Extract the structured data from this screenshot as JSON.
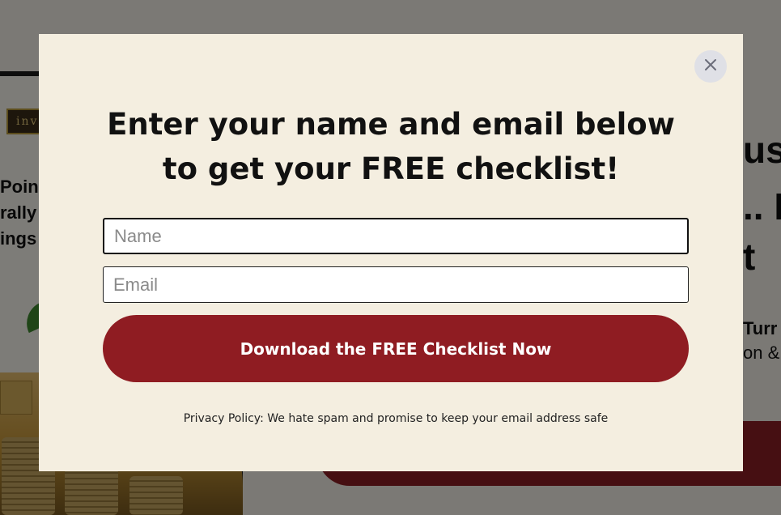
{
  "background": {
    "logo_text": "inv",
    "book_lines": [
      "Poin",
      "rally",
      "ings"
    ],
    "headline_fragments": [
      "ust",
      ".. I",
      "t"
    ],
    "subtext_fragments": [
      "Turr",
      "on &"
    ]
  },
  "modal": {
    "heading_line1": "Enter your name and email below",
    "heading_line2": "to get your FREE checklist!",
    "name_placeholder": "Name",
    "email_placeholder": "Email",
    "cta_label": "Download the FREE Checklist Now",
    "privacy_text": "Privacy Policy: We hate spam and promise to keep your email address safe"
  },
  "colors": {
    "modal_bg": "#f4eee0",
    "cta_bg": "#8f1c22",
    "close_bg": "#dfe0e6"
  }
}
